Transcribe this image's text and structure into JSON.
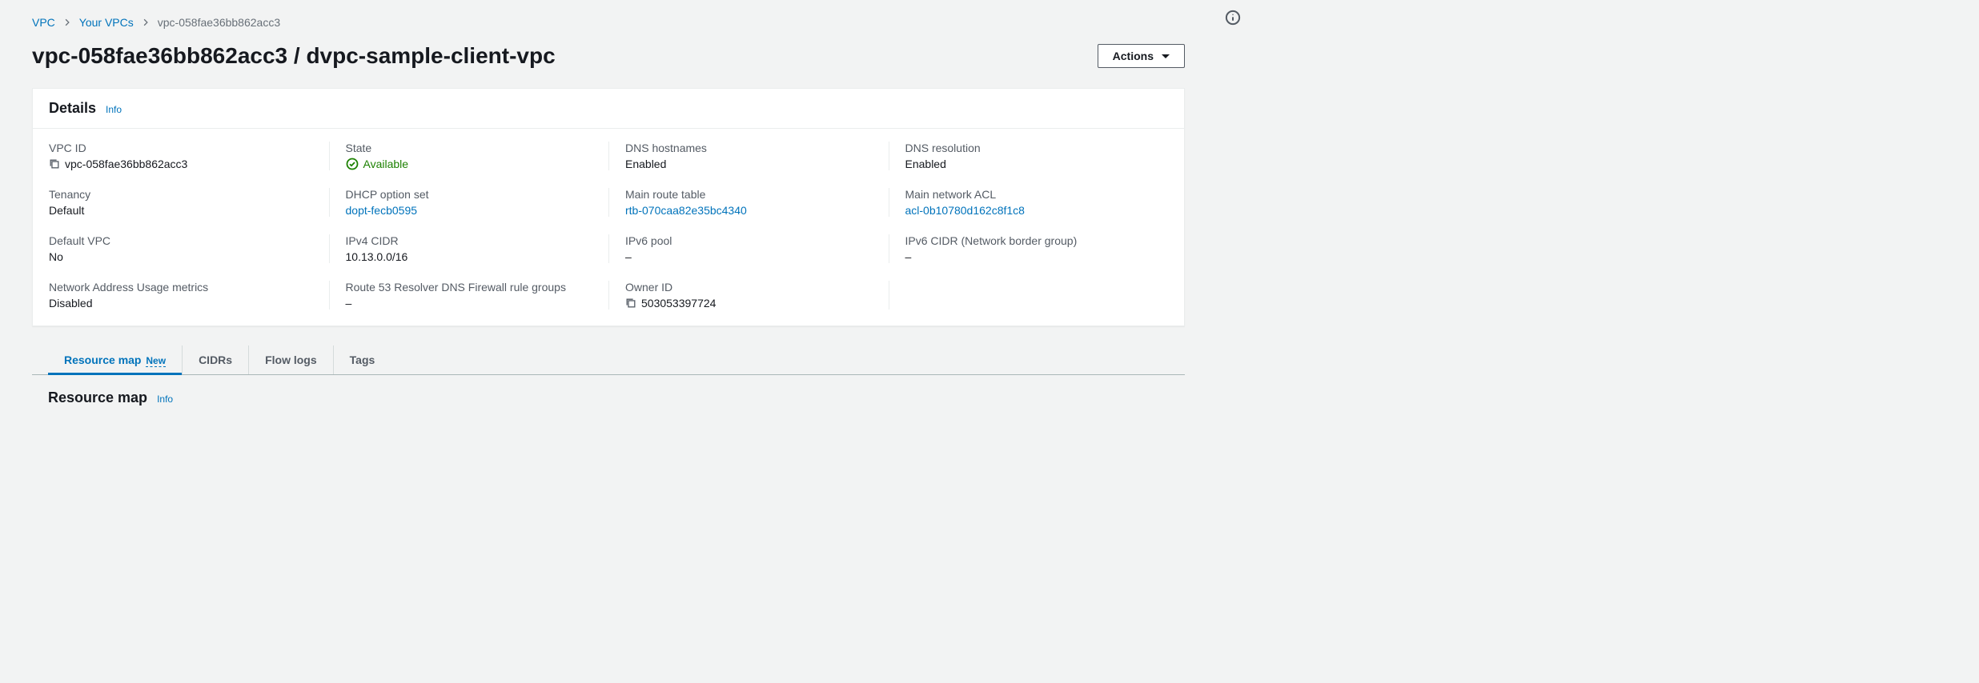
{
  "breadcrumb": {
    "root": "VPC",
    "level1": "Your VPCs",
    "current": "vpc-058fae36bb862acc3"
  },
  "header": {
    "title": "vpc-058fae36bb862acc3 / dvpc-sample-client-vpc",
    "actions_label": "Actions"
  },
  "details": {
    "title": "Details",
    "info_label": "Info",
    "fields": {
      "vpc_id": {
        "label": "VPC ID",
        "value": "vpc-058fae36bb862acc3"
      },
      "state": {
        "label": "State",
        "value": "Available"
      },
      "dns_hostnames": {
        "label": "DNS hostnames",
        "value": "Enabled"
      },
      "dns_resolution": {
        "label": "DNS resolution",
        "value": "Enabled"
      },
      "tenancy": {
        "label": "Tenancy",
        "value": "Default"
      },
      "dhcp": {
        "label": "DHCP option set",
        "value": "dopt-fecb0595"
      },
      "main_route": {
        "label": "Main route table",
        "value": "rtb-070caa82e35bc4340"
      },
      "main_acl": {
        "label": "Main network ACL",
        "value": "acl-0b10780d162c8f1c8"
      },
      "default_vpc": {
        "label": "Default VPC",
        "value": "No"
      },
      "ipv4_cidr": {
        "label": "IPv4 CIDR",
        "value": "10.13.0.0/16"
      },
      "ipv6_pool": {
        "label": "IPv6 pool",
        "value": "–"
      },
      "ipv6_cidr": {
        "label": "IPv6 CIDR (Network border group)",
        "value": "–"
      },
      "nau": {
        "label": "Network Address Usage metrics",
        "value": "Disabled"
      },
      "r53": {
        "label": "Route 53 Resolver DNS Firewall rule groups",
        "value": "–"
      },
      "owner": {
        "label": "Owner ID",
        "value": "503053397724"
      }
    }
  },
  "tabs": {
    "resource_map": "Resource map",
    "new_badge": "New",
    "cidrs": "CIDRs",
    "flow_logs": "Flow logs",
    "tags": "Tags"
  },
  "resource_map": {
    "title": "Resource map",
    "info_label": "Info"
  }
}
